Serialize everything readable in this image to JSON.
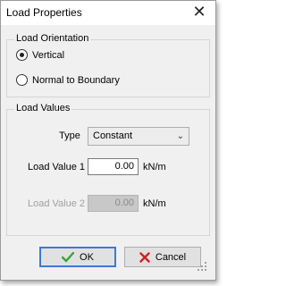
{
  "window": {
    "title": "Load Properties",
    "close_glyph": "✕"
  },
  "orientation": {
    "group_title": "Load Orientation",
    "options": [
      {
        "label": "Vertical",
        "checked": true
      },
      {
        "label": "Normal to Boundary",
        "checked": false
      }
    ]
  },
  "values": {
    "group_title": "Load Values",
    "type_label": "Type",
    "type_value": "Constant",
    "load1_label": "Load Value 1",
    "load1_value": "0.00",
    "load1_unit": "kN/m",
    "load2_label": "Load Value 2",
    "load2_value": "0.00",
    "load2_unit": "kN/m"
  },
  "buttons": {
    "ok": "OK",
    "cancel": "Cancel"
  },
  "icons": {
    "ok": "checkmark-icon",
    "cancel": "cross-icon",
    "close": "close-icon",
    "dropdown": "chevron-down-icon"
  },
  "colors": {
    "ok_check": "#3aa33a",
    "cancel_cross": "#d22020",
    "default_border": "#3a7bd5"
  }
}
